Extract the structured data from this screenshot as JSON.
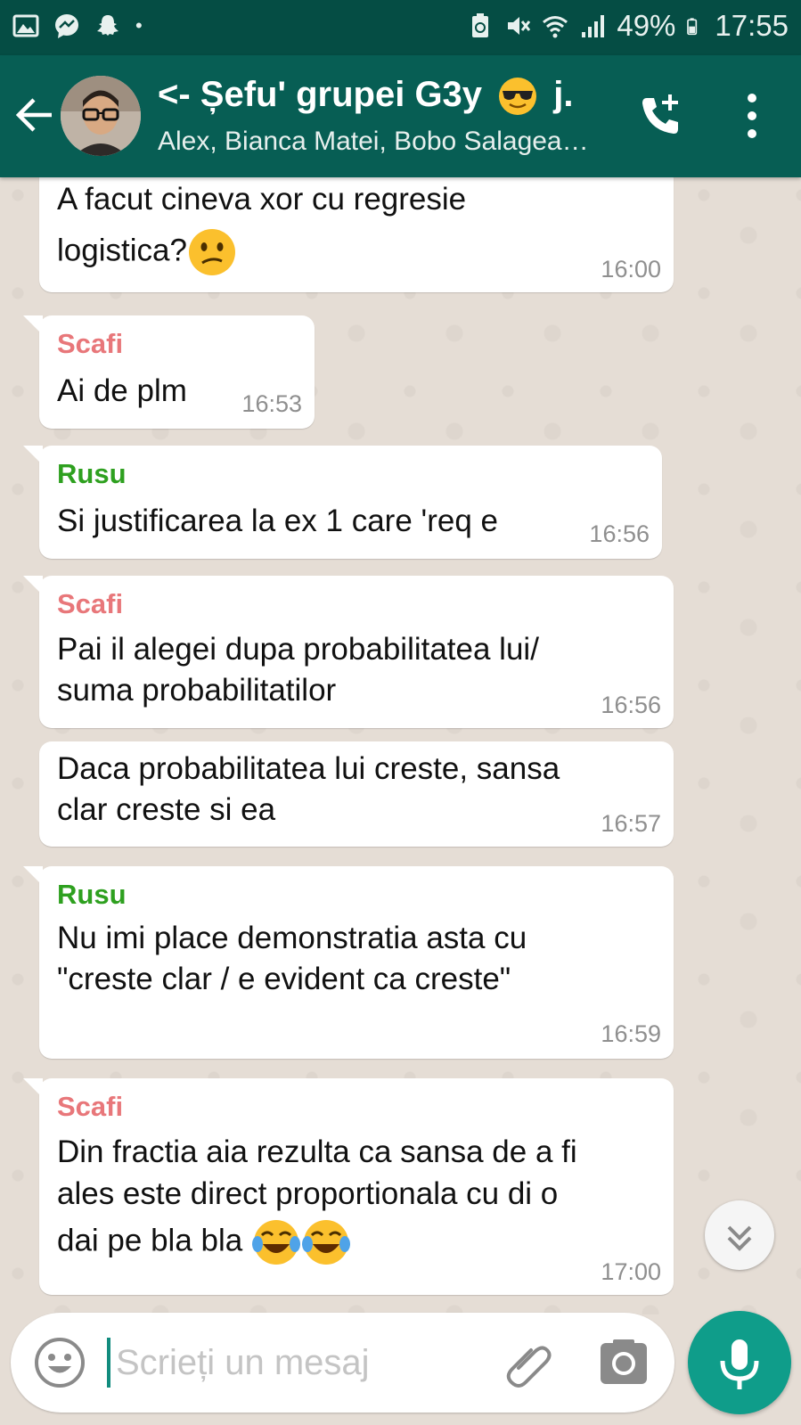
{
  "status_bar": {
    "battery": "49%",
    "time": "17:55",
    "dot": "•",
    "icons": [
      "gallery-icon",
      "messenger-icon",
      "snapchat-icon",
      "battery-saver-icon",
      "mute-icon",
      "wifi-icon",
      "signal-icon",
      "battery-icon"
    ]
  },
  "header": {
    "title": "<- Șefu' grupei G3y",
    "title_suffix": "j.",
    "subtitle": "Alex, Bianca Matei, Bobo Salagea…"
  },
  "colors": {
    "header_bg": "#075e54",
    "status_bg": "#054d44",
    "scafi": "#e8777a",
    "rusu": "#2ea01f",
    "mic_bg": "#0f9d8a"
  },
  "messages": [
    {
      "sender": "",
      "lines": [
        "A facut cineva xor cu regresie",
        "logistica?"
      ],
      "time": "16:00"
    },
    {
      "sender": "Scafi",
      "lines": [
        "Ai de plm"
      ],
      "time": "16:53"
    },
    {
      "sender": "Rusu",
      "lines": [
        "Si justificarea la ex 1 care 'req e"
      ],
      "time": "16:56"
    },
    {
      "sender": "Scafi",
      "lines": [
        "Pai il alegei dupa probabilitatea lui/",
        "suma probabilitatilor"
      ],
      "time": "16:56"
    },
    {
      "sender": "",
      "lines": [
        "Daca probabilitatea lui creste, sansa",
        "clar creste si ea"
      ],
      "time": "16:57"
    },
    {
      "sender": "Rusu",
      "lines": [
        "Nu imi place demonstratia asta cu",
        "\"creste clar / e evident ca creste\""
      ],
      "time": "16:59"
    },
    {
      "sender": "Scafi",
      "lines": [
        "Din fractia aia rezulta ca sansa de a fi",
        "ales este direct proportionala cu di o",
        "dai pe bla bla"
      ],
      "time": "17:00"
    }
  ],
  "composer": {
    "placeholder": "Scrieți un mesaj"
  }
}
